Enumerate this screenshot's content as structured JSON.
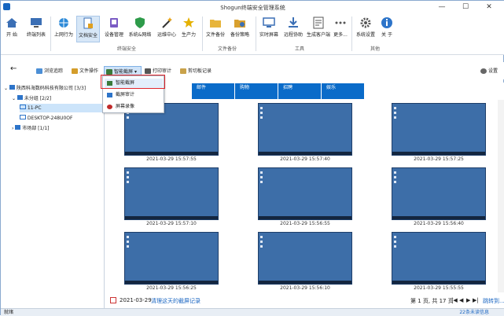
{
  "window": {
    "title": "Shogun终端安全管理系统",
    "controls": [
      "—",
      "☐",
      "✕"
    ]
  },
  "ribbon": {
    "buttons": [
      {
        "label": "开 始",
        "icon": "home-icon"
      },
      {
        "label": "终端列表",
        "icon": "monitor-icon"
      },
      {
        "label": "上网行为",
        "icon": "globe-icon"
      },
      {
        "label": "文档安全",
        "icon": "document-lock-icon"
      },
      {
        "label": "设备管理",
        "icon": "device-icon"
      },
      {
        "label": "系统&网络",
        "icon": "shield-icon"
      },
      {
        "label": "运维中心",
        "icon": "wand-icon"
      },
      {
        "label": "生产力",
        "icon": "star-icon"
      },
      {
        "label": "文件备份",
        "icon": "folder-icon"
      },
      {
        "label": "备份策略",
        "icon": "backup-icon"
      },
      {
        "label": "实时屏幕",
        "icon": "screen-icon"
      },
      {
        "label": "远程协助",
        "icon": "download-icon"
      },
      {
        "label": "生成客户端",
        "icon": "client-icon"
      },
      {
        "label": "更多...",
        "icon": "more-icon"
      },
      {
        "label": "系统设置",
        "icon": "gear-icon"
      },
      {
        "label": "关 于",
        "icon": "info-icon"
      }
    ],
    "groups": [
      "终端安全",
      "文件备份",
      "工具",
      "其他"
    ]
  },
  "toolbar": {
    "back": "←",
    "items": [
      "浏览追踪",
      "文件操作",
      "智能截屏",
      "打印审计",
      "剪切板记录"
    ],
    "settings": "设置"
  },
  "sidebar": {
    "root": "陕西科海数码科技有限公司 [3/3]",
    "group": "未分组 [2/2]",
    "pc1": "11-PC",
    "pc2": "DESKTOP-248U0OF",
    "market": "市场部 [1/1]"
  },
  "tabs": [
    "邮件",
    "购物",
    "招聘",
    "娱乐"
  ],
  "thumbnails": [
    "2021-03-29 15:57:55",
    "2021-03-29 15:57:40",
    "2021-03-29 15:57:25",
    "2021-03-29 15:57:10",
    "2021-03-29 15:56:55",
    "2021-03-29 15:56:40",
    "2021-03-29 15:56:25",
    "2021-03-29 15:56:10",
    "2021-03-29 15:55:55"
  ],
  "footer": {
    "date": "2021-03-29",
    "clear_link": "清理这天的截屏记录",
    "pager": "第 1 页, 共 17 页",
    "pager_icons": [
      "|◀",
      "◀",
      "▶",
      "▶|"
    ],
    "more": "跳转到..."
  },
  "dropdown": [
    {
      "label": "智能截屏",
      "icon": "image-icon"
    },
    {
      "label": "截屏审计",
      "icon": "audit-icon"
    },
    {
      "label": "屏幕录像",
      "icon": "record-icon"
    }
  ],
  "status": {
    "left": "就绪",
    "right": "22条未读信息"
  }
}
